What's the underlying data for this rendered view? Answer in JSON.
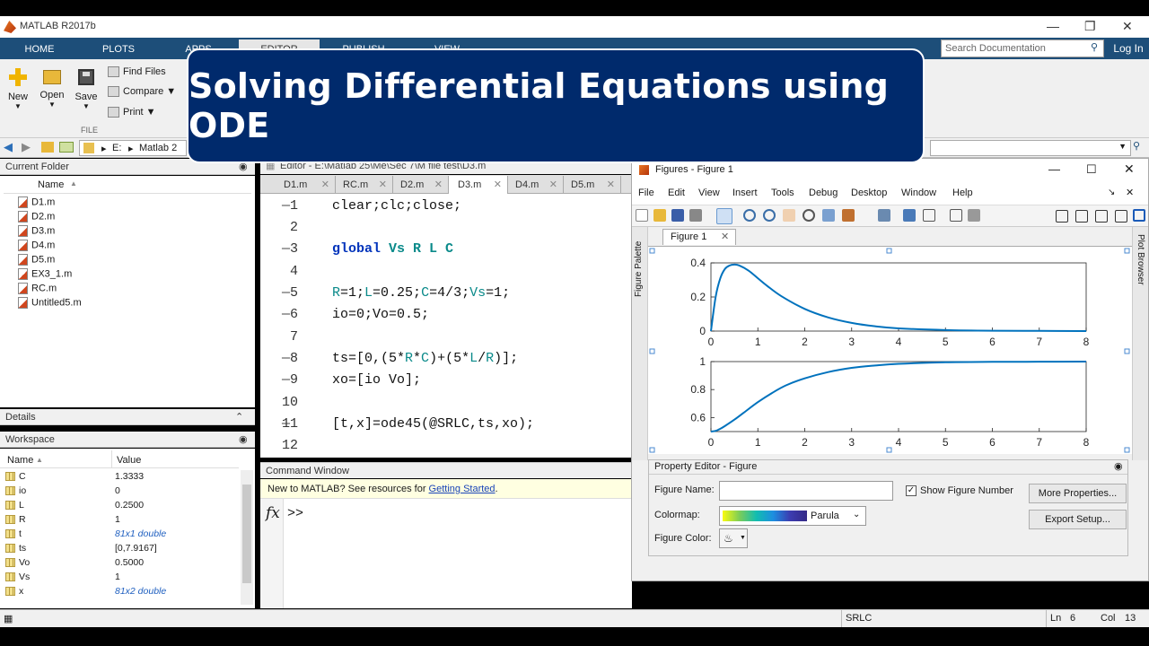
{
  "app": {
    "title": "MATLAB R2017b"
  },
  "ribbon_tabs": [
    "HOME",
    "PLOTS",
    "APPS",
    "EDITOR",
    "PUBLISH",
    "VIEW"
  ],
  "search": {
    "placeholder": "Search Documentation"
  },
  "login": "Log In",
  "ribbon": {
    "new": "New",
    "open": "Open",
    "save": "Save",
    "find_files": "Find Files",
    "compare": "Compare",
    "print": "Print",
    "section": "FILE"
  },
  "address": {
    "drive": "E:",
    "folder": "Matlab 2"
  },
  "banner": {
    "text": "Solving Differential Equations using ODE"
  },
  "current_folder": {
    "header": "Current Folder",
    "name_col": "Name",
    "files": [
      "D1.m",
      "D2.m",
      "D3.m",
      "D4.m",
      "D5.m",
      "EX3_1.m",
      "RC.m",
      "Untitled5.m"
    ]
  },
  "details": {
    "header": "Details"
  },
  "workspace": {
    "header": "Workspace",
    "columns": [
      "Name",
      "Value"
    ],
    "rows": [
      {
        "name": "C",
        "value": "1.3333"
      },
      {
        "name": "io",
        "value": "0"
      },
      {
        "name": "L",
        "value": "0.2500"
      },
      {
        "name": "R",
        "value": "1"
      },
      {
        "name": "t",
        "value": "81x1 double"
      },
      {
        "name": "ts",
        "value": "[0,7.9167]"
      },
      {
        "name": "Vo",
        "value": "0.5000"
      },
      {
        "name": "Vs",
        "value": "1"
      },
      {
        "name": "x",
        "value": "81x2 double"
      }
    ]
  },
  "editor": {
    "header": "Editor - E:\\Matlab 25\\Me\\Sec 7\\M file test\\D3.m",
    "tabs": [
      "D1.m",
      "RC.m",
      "D2.m",
      "D3.m",
      "D4.m",
      "D5.m"
    ],
    "active_tab": "D3.m",
    "lines": [
      "1",
      "2",
      "3",
      "4",
      "5",
      "6",
      "7",
      "8",
      "9",
      "10",
      "11",
      "12"
    ],
    "code": {
      "l1": "clear;clc;close;",
      "l3_kw": "global",
      "l3_vars": " Vs R L C",
      "l5_a": "R",
      "l5_b": "=1;",
      "l5_c": "L",
      "l5_d": "=0.25;",
      "l5_e": "C",
      "l5_f": "=4/3;",
      "l5_g": "Vs",
      "l5_h": "=1;",
      "l6": "io=0;Vo=0.5;",
      "l8_a": "ts=[0,(5*",
      "l8_b": "R",
      "l8_c": "*",
      "l8_d": "C",
      "l8_e": ")+(5*",
      "l8_f": "L",
      "l8_g": "/",
      "l8_h": "R",
      "l8_i": ")];",
      "l9": "xo=[io Vo];",
      "l11": "[t,x]=ode45(@SRLC,ts,xo);"
    }
  },
  "command_window": {
    "header": "Command Window",
    "note": "New to MATLAB? See resources for ",
    "link": "Getting Started",
    "note_end": ".",
    "fx": "fx",
    "prompt": ">>"
  },
  "figure": {
    "title": "Figures - Figure 1",
    "menu": [
      "File",
      "Edit",
      "View",
      "Insert",
      "Tools",
      "Debug",
      "Desktop",
      "Window",
      "Help"
    ],
    "tab": "Figure 1",
    "palette": "Figure Palette",
    "plot_browser": "Plot Browser"
  },
  "chart_data": [
    {
      "type": "line",
      "x": [
        0,
        0.1,
        0.2,
        0.3,
        0.4,
        0.5,
        0.6,
        0.8,
        1.0,
        1.2,
        1.5,
        2.0,
        2.5,
        3.0,
        3.5,
        4.0,
        5.0,
        6.0,
        7.0,
        8.0
      ],
      "y": [
        0,
        0.2,
        0.31,
        0.365,
        0.385,
        0.39,
        0.385,
        0.355,
        0.31,
        0.265,
        0.205,
        0.13,
        0.08,
        0.048,
        0.028,
        0.016,
        0.006,
        0.002,
        0.001,
        0
      ],
      "xlim": [
        0,
        8
      ],
      "ylim": [
        0,
        0.4
      ],
      "xticks": [
        "0",
        "1",
        "2",
        "3",
        "4",
        "5",
        "6",
        "7",
        "8"
      ],
      "yticks": [
        "0",
        "0.2",
        "0.4"
      ],
      "color": "#0072bd"
    },
    {
      "type": "line",
      "x": [
        0,
        0.1,
        0.2,
        0.3,
        0.5,
        0.7,
        1.0,
        1.3,
        1.6,
        2.0,
        2.5,
        3.0,
        3.5,
        4.0,
        5.0,
        6.0,
        7.0,
        8.0
      ],
      "y": [
        0.5,
        0.505,
        0.52,
        0.54,
        0.585,
        0.635,
        0.71,
        0.775,
        0.83,
        0.88,
        0.925,
        0.955,
        0.972,
        0.984,
        0.995,
        0.998,
        0.999,
        1.0
      ],
      "xlim": [
        0,
        8
      ],
      "ylim": [
        0.5,
        1
      ],
      "xticks": [
        "0",
        "1",
        "2",
        "3",
        "4",
        "5",
        "6",
        "7",
        "8"
      ],
      "yticks": [
        "0.6",
        "0.8",
        "1"
      ],
      "color": "#0072bd"
    }
  ],
  "property_editor": {
    "header": "Property Editor - Figure",
    "figure_name_label": "Figure Name:",
    "figure_name_value": "",
    "show_number_label": "Show Figure Number",
    "colormap_label": "Colormap:",
    "colormap_value": "Parula",
    "figure_color_label": "Figure Color:",
    "more_props": "More Properties...",
    "export_setup": "Export Setup..."
  },
  "status": {
    "func": "SRLC",
    "ln_label": "Ln",
    "ln": "6",
    "col_label": "Col",
    "col": "13"
  }
}
